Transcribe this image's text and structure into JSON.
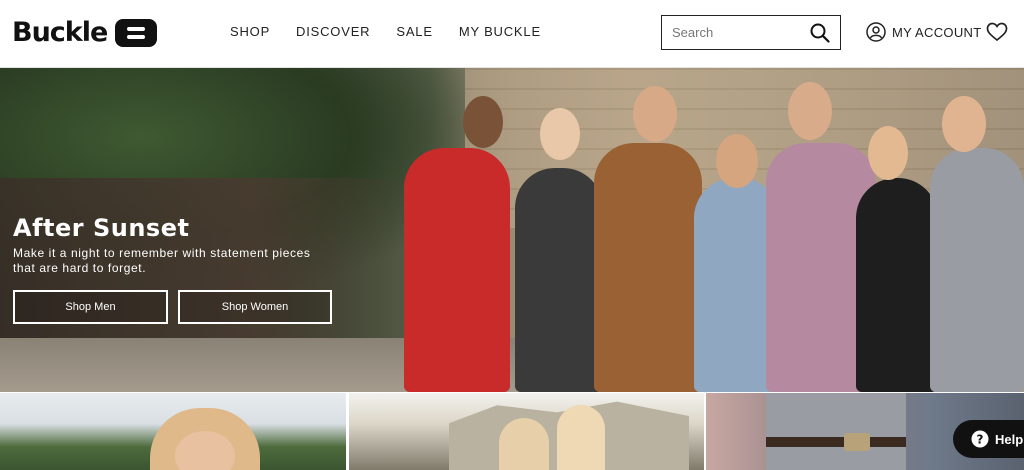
{
  "header": {
    "logo_text": "Buckle",
    "nav": [
      {
        "label": "SHOP"
      },
      {
        "label": "DISCOVER"
      },
      {
        "label": "SALE"
      },
      {
        "label": "MY BUCKLE"
      }
    ],
    "search": {
      "placeholder": "Search",
      "value": "",
      "icon": "search-icon"
    },
    "account_label": "MY ACCOUNT",
    "account_icon": "user-circle-icon",
    "wishlist_icon": "heart-icon"
  },
  "hero": {
    "title": "After Sunset",
    "subtitle": "Make it a night to remember with statement pieces that are hard to forget.",
    "buttons": [
      {
        "label": "Shop Men"
      },
      {
        "label": "Shop Women"
      }
    ]
  },
  "help": {
    "label": "Help",
    "icon": "question-circle-icon"
  },
  "colors": {
    "brand": "#111111",
    "hero_text": "#ffffff"
  }
}
